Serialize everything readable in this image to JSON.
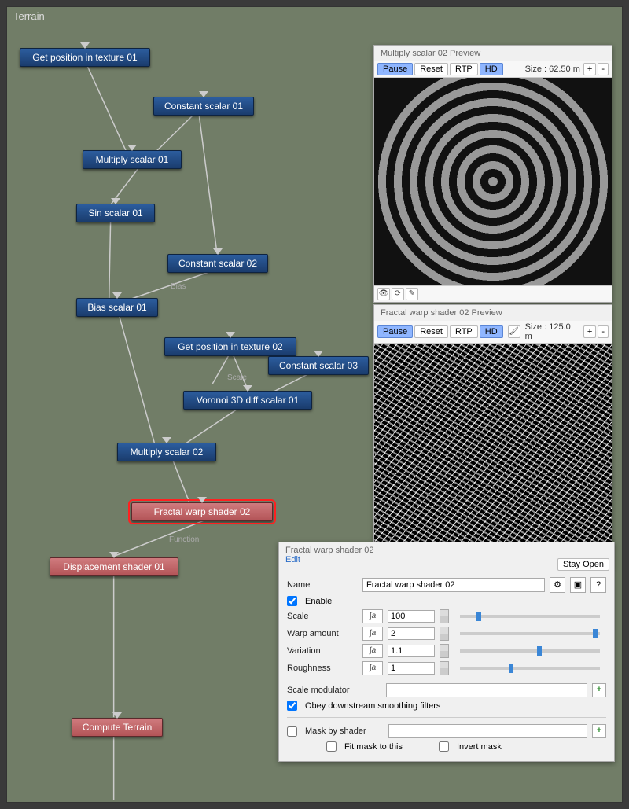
{
  "canvas_title": "Terrain",
  "nodes": {
    "get_pos_1": "Get position in texture 01",
    "const_1": "Constant scalar 01",
    "mult_1": "Multiply scalar 01",
    "sin_1": "Sin scalar 01",
    "const_2": "Constant scalar 02",
    "bias_1": "Bias scalar 01",
    "get_pos_2": "Get position in texture 02",
    "const_3": "Constant scalar 03",
    "voronoi": "Voronoi 3D diff scalar 01",
    "mult_2": "Multiply scalar 02",
    "fractal": "Fractal warp shader 02",
    "disp": "Displacement shader 01",
    "compute": "Compute Terrain"
  },
  "wire_labels": {
    "bias": "Bias",
    "scale": "Scale",
    "function": "Function"
  },
  "preview1": {
    "title": "Multiply scalar 02 Preview",
    "pause": "Pause",
    "reset": "Reset",
    "rtp": "RTP",
    "hd": "HD",
    "size_label": "Size : 62.50 m",
    "plus": "+",
    "minus": "-"
  },
  "preview2": {
    "title": "Fractal warp shader 02 Preview",
    "pause": "Pause",
    "reset": "Reset",
    "rtp": "RTP",
    "hd": "HD",
    "size_label": "Size : 125.0 m",
    "plus": "+",
    "minus": "-"
  },
  "param": {
    "title": "Fractal warp shader 02",
    "edit": "Edit",
    "stay_open": "Stay Open",
    "name_label": "Name",
    "name_value": "Fractal warp shader 02",
    "enable": "Enable",
    "scale_label": "Scale",
    "scale_value": "100",
    "warp_label": "Warp amount",
    "warp_value": "2",
    "variation_label": "Variation",
    "variation_value": "1.1",
    "roughness_label": "Roughness",
    "roughness_value": "1",
    "scale_mod_label": "Scale modulator",
    "obey": "Obey downstream smoothing filters",
    "mask_label": "Mask by shader",
    "fit_label": "Fit mask to this",
    "invert_label": "Invert mask",
    "help": "?"
  }
}
